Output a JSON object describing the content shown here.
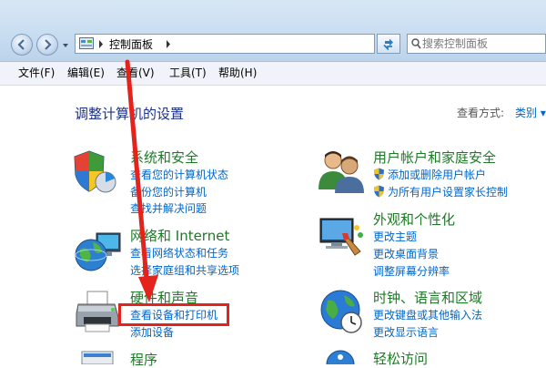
{
  "address": {
    "crumb": "控制面板"
  },
  "search": {
    "placeholder": "搜索控制面板"
  },
  "menu": [
    "文件(F)",
    "编辑(E)",
    "查看(V)",
    "工具(T)",
    "帮助(H)"
  ],
  "page_title": "调整计算机的设置",
  "view_by": {
    "label": "查看方式:",
    "value": "类别 ▾"
  },
  "categories_left": [
    {
      "title": "系统和安全",
      "links": [
        "查看您的计算机状态",
        "备份您的计算机",
        "查找并解决问题"
      ],
      "icon": "system-security-icon"
    },
    {
      "title": "网络和 Internet",
      "links": [
        "查看网络状态和任务",
        "选择家庭组和共享选项"
      ],
      "icon": "network-globe-icon"
    },
    {
      "title": "硬件和声音",
      "links": [
        "查看设备和打印机",
        "添加设备"
      ],
      "icon": "printer-icon"
    },
    {
      "title": "程序",
      "links": [],
      "icon": "programs-icon"
    }
  ],
  "categories_right": [
    {
      "title": "用户帐户和家庭安全",
      "links": [
        "添加或删除用户帐户",
        "为所有用户设置家长控制"
      ],
      "icon": "users-icon"
    },
    {
      "title": "外观和个性化",
      "links": [
        "更改主题",
        "更改桌面背景",
        "调整屏幕分辨率"
      ],
      "icon": "monitor-paint-icon"
    },
    {
      "title": "时钟、语言和区域",
      "links": [
        "更改键盘或其他输入法",
        "更改显示语言"
      ],
      "icon": "clock-globe-icon"
    },
    {
      "title": "轻松访问",
      "links": [],
      "icon": "ease-access-icon"
    }
  ],
  "colors": {
    "heading_green": "#1d7a26",
    "link_blue": "#0066cc",
    "title_blue": "#1e3287",
    "highlight_red": "#e3231c"
  }
}
